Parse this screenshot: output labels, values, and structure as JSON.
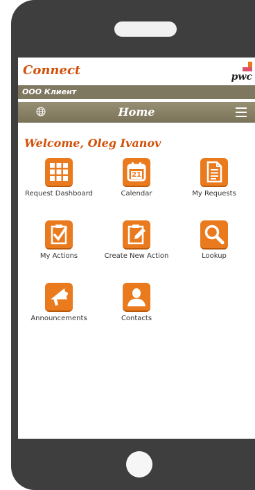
{
  "header": {
    "brand": "Connect",
    "logo_text": "pwc"
  },
  "client": {
    "name": "ООО Клиент"
  },
  "nav": {
    "title": "Home",
    "globe_icon": "globe-icon",
    "menu_icon": "hamburger-menu-icon"
  },
  "welcome": {
    "text": "Welcome, Oleg Ivanov"
  },
  "calendar_day": "21",
  "tiles": [
    {
      "label": "Request Dashboard",
      "icon": "grid-icon"
    },
    {
      "label": "Calendar",
      "icon": "calendar-icon"
    },
    {
      "label": "My Requests",
      "icon": "document-icon"
    },
    {
      "label": "My Actions",
      "icon": "checklist-icon"
    },
    {
      "label": "Create New Action",
      "icon": "edit-clipboard-icon"
    },
    {
      "label": "Lookup",
      "icon": "search-icon"
    },
    {
      "label": "Announcements",
      "icon": "megaphone-icon"
    },
    {
      "label": "Contacts",
      "icon": "person-icon"
    }
  ],
  "colors": {
    "accent": "#d1510a",
    "tile": "#ea7a1e",
    "bar": "#7f7861"
  }
}
